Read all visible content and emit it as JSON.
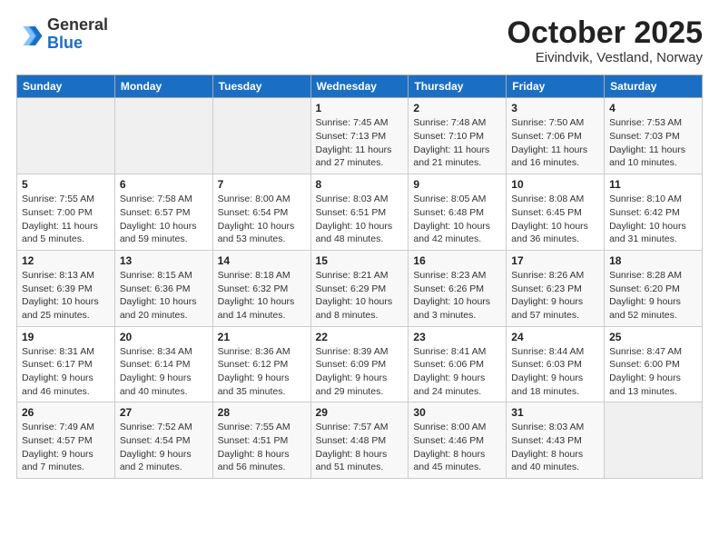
{
  "header": {
    "logo_general": "General",
    "logo_blue": "Blue",
    "month_title": "October 2025",
    "location": "Eivindvik, Vestland, Norway"
  },
  "weekdays": [
    "Sunday",
    "Monday",
    "Tuesday",
    "Wednesday",
    "Thursday",
    "Friday",
    "Saturday"
  ],
  "weeks": [
    [
      {
        "day": "",
        "info": ""
      },
      {
        "day": "",
        "info": ""
      },
      {
        "day": "",
        "info": ""
      },
      {
        "day": "1",
        "info": "Sunrise: 7:45 AM\nSunset: 7:13 PM\nDaylight: 11 hours\nand 27 minutes."
      },
      {
        "day": "2",
        "info": "Sunrise: 7:48 AM\nSunset: 7:10 PM\nDaylight: 11 hours\nand 21 minutes."
      },
      {
        "day": "3",
        "info": "Sunrise: 7:50 AM\nSunset: 7:06 PM\nDaylight: 11 hours\nand 16 minutes."
      },
      {
        "day": "4",
        "info": "Sunrise: 7:53 AM\nSunset: 7:03 PM\nDaylight: 11 hours\nand 10 minutes."
      }
    ],
    [
      {
        "day": "5",
        "info": "Sunrise: 7:55 AM\nSunset: 7:00 PM\nDaylight: 11 hours\nand 5 minutes."
      },
      {
        "day": "6",
        "info": "Sunrise: 7:58 AM\nSunset: 6:57 PM\nDaylight: 10 hours\nand 59 minutes."
      },
      {
        "day": "7",
        "info": "Sunrise: 8:00 AM\nSunset: 6:54 PM\nDaylight: 10 hours\nand 53 minutes."
      },
      {
        "day": "8",
        "info": "Sunrise: 8:03 AM\nSunset: 6:51 PM\nDaylight: 10 hours\nand 48 minutes."
      },
      {
        "day": "9",
        "info": "Sunrise: 8:05 AM\nSunset: 6:48 PM\nDaylight: 10 hours\nand 42 minutes."
      },
      {
        "day": "10",
        "info": "Sunrise: 8:08 AM\nSunset: 6:45 PM\nDaylight: 10 hours\nand 36 minutes."
      },
      {
        "day": "11",
        "info": "Sunrise: 8:10 AM\nSunset: 6:42 PM\nDaylight: 10 hours\nand 31 minutes."
      }
    ],
    [
      {
        "day": "12",
        "info": "Sunrise: 8:13 AM\nSunset: 6:39 PM\nDaylight: 10 hours\nand 25 minutes."
      },
      {
        "day": "13",
        "info": "Sunrise: 8:15 AM\nSunset: 6:36 PM\nDaylight: 10 hours\nand 20 minutes."
      },
      {
        "day": "14",
        "info": "Sunrise: 8:18 AM\nSunset: 6:32 PM\nDaylight: 10 hours\nand 14 minutes."
      },
      {
        "day": "15",
        "info": "Sunrise: 8:21 AM\nSunset: 6:29 PM\nDaylight: 10 hours\nand 8 minutes."
      },
      {
        "day": "16",
        "info": "Sunrise: 8:23 AM\nSunset: 6:26 PM\nDaylight: 10 hours\nand 3 minutes."
      },
      {
        "day": "17",
        "info": "Sunrise: 8:26 AM\nSunset: 6:23 PM\nDaylight: 9 hours\nand 57 minutes."
      },
      {
        "day": "18",
        "info": "Sunrise: 8:28 AM\nSunset: 6:20 PM\nDaylight: 9 hours\nand 52 minutes."
      }
    ],
    [
      {
        "day": "19",
        "info": "Sunrise: 8:31 AM\nSunset: 6:17 PM\nDaylight: 9 hours\nand 46 minutes."
      },
      {
        "day": "20",
        "info": "Sunrise: 8:34 AM\nSunset: 6:14 PM\nDaylight: 9 hours\nand 40 minutes."
      },
      {
        "day": "21",
        "info": "Sunrise: 8:36 AM\nSunset: 6:12 PM\nDaylight: 9 hours\nand 35 minutes."
      },
      {
        "day": "22",
        "info": "Sunrise: 8:39 AM\nSunset: 6:09 PM\nDaylight: 9 hours\nand 29 minutes."
      },
      {
        "day": "23",
        "info": "Sunrise: 8:41 AM\nSunset: 6:06 PM\nDaylight: 9 hours\nand 24 minutes."
      },
      {
        "day": "24",
        "info": "Sunrise: 8:44 AM\nSunset: 6:03 PM\nDaylight: 9 hours\nand 18 minutes."
      },
      {
        "day": "25",
        "info": "Sunrise: 8:47 AM\nSunset: 6:00 PM\nDaylight: 9 hours\nand 13 minutes."
      }
    ],
    [
      {
        "day": "26",
        "info": "Sunrise: 7:49 AM\nSunset: 4:57 PM\nDaylight: 9 hours\nand 7 minutes."
      },
      {
        "day": "27",
        "info": "Sunrise: 7:52 AM\nSunset: 4:54 PM\nDaylight: 9 hours\nand 2 minutes."
      },
      {
        "day": "28",
        "info": "Sunrise: 7:55 AM\nSunset: 4:51 PM\nDaylight: 8 hours\nand 56 minutes."
      },
      {
        "day": "29",
        "info": "Sunrise: 7:57 AM\nSunset: 4:48 PM\nDaylight: 8 hours\nand 51 minutes."
      },
      {
        "day": "30",
        "info": "Sunrise: 8:00 AM\nSunset: 4:46 PM\nDaylight: 8 hours\nand 45 minutes."
      },
      {
        "day": "31",
        "info": "Sunrise: 8:03 AM\nSunset: 4:43 PM\nDaylight: 8 hours\nand 40 minutes."
      },
      {
        "day": "",
        "info": ""
      }
    ]
  ]
}
